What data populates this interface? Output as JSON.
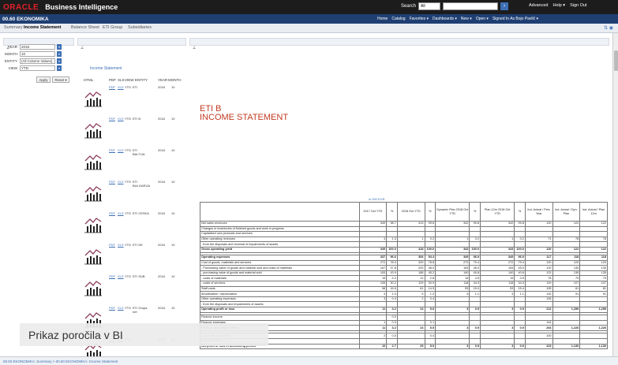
{
  "header": {
    "logo": "ORACLE",
    "title": "Business Intelligence",
    "search_label": "Search",
    "search_scope": "All",
    "links": [
      "Advanced",
      "Help ▾",
      "Sign Out"
    ]
  },
  "subbar": {
    "title": "00.60 EKONOMIKA",
    "links": [
      "Home",
      "Catalog",
      "Favorites ▾",
      "Dashboards ▾",
      "New ▾",
      "Open ▾",
      "Signed In As  Bojo Pavlič ▾"
    ]
  },
  "tabs": [
    "Summary",
    "Income Statement",
    "Balance Sheet",
    "ETI Group",
    "Subsidiaries"
  ],
  "prompts": {
    "year_label": "YEAR",
    "year": "2018",
    "month_label": "MONTH",
    "month": "10",
    "entity_label": "ENTITY",
    "entity": "(All Column Values)",
    "view_label": "VIEW",
    "view": "YTD",
    "apply": "Apply",
    "reset": "Reset ▾"
  },
  "list": {
    "title": "Income Statement",
    "headers": [
      "HTML",
      "PDF",
      "XLS",
      "VIEW",
      "ENTITY",
      "YEAR",
      "MONTH"
    ],
    "rows": [
      {
        "pdf": "PDF",
        "xls": "XLS",
        "view": "YTD",
        "entity": "ETI",
        "year": "2018",
        "month": "10"
      },
      {
        "pdf": "PDF",
        "xls": "XLS",
        "view": "YTD",
        "entity": "ETI B",
        "year": "2018",
        "month": "10"
      },
      {
        "pdf": "PDF",
        "xls": "XLS",
        "view": "YTD",
        "entity": "ETI BALTIJA",
        "year": "2018",
        "month": "10"
      },
      {
        "pdf": "PDF",
        "xls": "XLS",
        "view": "YTD",
        "entity": "ETI BULGARIJA",
        "year": "2018",
        "month": "10"
      },
      {
        "pdf": "PDF",
        "xls": "XLS",
        "view": "YTD",
        "entity": "ETI CESKA",
        "year": "2018",
        "month": "10"
      },
      {
        "pdf": "PDF",
        "xls": "XLS",
        "view": "YTD",
        "entity": "ETI DE",
        "year": "2018",
        "month": "10"
      },
      {
        "pdf": "PDF",
        "xls": "XLS",
        "view": "YTD",
        "entity": "ETI SUB",
        "year": "2018",
        "month": "10"
      },
      {
        "pdf": "PDF",
        "xls": "XLS",
        "view": "YTD",
        "entity": "ETI Grupa net",
        "year": "2018",
        "month": "10"
      },
      {
        "pdf": "PDF",
        "xls": "XLS",
        "view": "YTD",
        "entity": "",
        "year": "2018",
        "month": "10"
      }
    ]
  },
  "report": {
    "title1": "ETI B",
    "title2": "INCOME STATEMENT",
    "units": "in 000 EUR",
    "columns": [
      "",
      "2017 Oct YTD",
      "%",
      "2018 Oct YTD",
      "%",
      "Dynamic Plan 2018 Oct YTD",
      "%",
      "Plan 12m 2018 Oct YTD",
      "%",
      "Ind. Actual / Prev Year",
      "Ind. Actual / Dyn. Plan",
      "Ind. Actual / Plan 12m"
    ],
    "rows": [
      {
        "cells": [
          "Net sales revenues",
          "349",
          "98.7",
          "413",
          "99.6",
          "342",
          "99.8",
          "342",
          "99.8",
          "120",
          "122",
          "122"
        ],
        "bold": false
      },
      {
        "cells": [
          "Changes in inventories of finished goods and work in progress",
          "",
          "",
          "",
          "",
          "",
          "",
          "",
          "",
          "",
          "",
          ""
        ],
        "bold": false
      },
      {
        "cells": [
          "Capitalized own products and services",
          "",
          "",
          "",
          "",
          "",
          "",
          "",
          "",
          "",
          "",
          ""
        ],
        "bold": false
      },
      {
        "cells": [
          "Other operating revenues",
          "4",
          "1.3",
          "1",
          "0.2",
          "1",
          "0.2",
          "1",
          "0.2",
          "71",
          "78",
          "78"
        ],
        "bold": false
      },
      {
        "cells": [
          "- from the disposals and reversal of impairments of assets",
          "",
          "",
          "",
          "",
          "",
          "",
          "",
          "",
          "",
          "",
          ""
        ],
        "bold": false
      },
      {
        "cells": [
          "Gross operating yield",
          "349",
          "100.0",
          "418",
          "100.0",
          "343",
          "100.0",
          "343",
          "100.0",
          "120",
          "122",
          "122"
        ],
        "bold": true
      },
      {
        "cells": [
          "",
          "",
          "",
          "",
          "",
          "",
          "",
          "",
          "",
          "",
          "",
          ""
        ],
        "bold": false,
        "gap": true
      },
      {
        "cells": [
          "Operating expenses",
          "337",
          "96.6",
          "394",
          "94.4",
          "349",
          "96.9",
          "349",
          "96.9",
          "117",
          "118",
          "118"
        ],
        "bold": true
      },
      {
        "cells": [
          "Cost of goods, materials and services",
          "272",
          "78.0",
          "329",
          "78.8",
          "272",
          "79.4",
          "272",
          "79.4",
          "120",
          "120",
          "120"
        ],
        "bold": false
      },
      {
        "cells": [
          "- Purchasing value of goods and material sold and costs of materials",
          "167",
          "47.8",
          "200",
          "48.0",
          "154",
          "45.0",
          "154",
          "45.0",
          "120",
          "130",
          "130"
        ],
        "bold": false
      },
      {
        "cells": [
          "- purchasing value of goods and material sold",
          "153",
          "43.9",
          "188",
          "45.2",
          "140",
          "40.8",
          "140",
          "40.8",
          "123",
          "135",
          "135"
        ],
        "bold": false
      },
      {
        "cells": [
          "- costs of materials",
          "15",
          "4.2",
          "12",
          "2.8",
          "16",
          "4.5",
          "15",
          "4.5",
          "78",
          "79",
          "79"
        ],
        "bold": false
      },
      {
        "cells": [
          "- costs of services",
          "105",
          "30.2",
          "129",
          "30.9",
          "118",
          "34.3",
          "118",
          "34.3",
          "119",
          "107",
          "107"
        ],
        "bold": false
      },
      {
        "cells": [
          "Staff costs",
          "58",
          "16.6",
          "61",
          "14.5",
          "53",
          "15.4",
          "53",
          "15.4",
          "105",
          "81",
          "81"
        ],
        "bold": false
      },
      {
        "cells": [
          "Amortization / depreciation",
          "4",
          "1.0",
          "5",
          "1.2",
          "4",
          "1.1",
          "4",
          "1.1",
          "132",
          "91",
          "91"
        ],
        "bold": false
      },
      {
        "cells": [
          "Other operating expenses",
          "3",
          "0.4",
          "2",
          "0.4",
          "",
          "",
          "",
          "",
          "126",
          "",
          ""
        ],
        "bold": false
      },
      {
        "cells": [
          "- from the disposals and impairments of assets",
          "",
          "",
          "",
          "",
          "",
          "",
          "",
          "",
          "",
          "",
          ""
        ],
        "bold": false
      },
      {
        "cells": [
          "Operating profit or loss",
          "11",
          "3.2",
          "24",
          "5.6",
          "3",
          "0.9",
          "3",
          "0.9",
          "212",
          "1,256",
          "1,256"
        ],
        "bold": true
      },
      {
        "cells": [
          "",
          "",
          "",
          "",
          "",
          "",
          "",
          "",
          "",
          "",
          "",
          ""
        ],
        "bold": false,
        "gap": true
      },
      {
        "cells": [
          "Finance income",
          "",
          "0.0",
          "",
          "",
          "",
          "",
          "",
          "",
          "",
          "",
          ""
        ],
        "bold": false
      },
      {
        "cells": [
          "Finance expenses",
          "1",
          "0.3",
          "",
          "0.1",
          "",
          "",
          "",
          "",
          "144",
          "",
          ""
        ],
        "bold": false
      },
      {
        "cells": [
          "Profit or loss before taxes",
          "11",
          "3.2",
          "23",
          "5.5",
          "3",
          "0.9",
          "3",
          "0.9",
          "204",
          "1,226",
          "1,226"
        ],
        "bold": true
      },
      {
        "cells": [
          "",
          "",
          "",
          "",
          "",
          "",
          "",
          "",
          "",
          "",
          "",
          ""
        ],
        "bold": false,
        "gap": true
      },
      {
        "cells": [
          "Corporate income tax",
          "2",
          "0.5",
          "",
          "0.4",
          "",
          "",
          "",
          "",
          "100",
          "",
          ""
        ],
        "bold": false
      },
      {
        "cells": [
          "Deferred taxes",
          "",
          "",
          "",
          "",
          "",
          "",
          "",
          "",
          "",
          "",
          ""
        ],
        "bold": false
      },
      {
        "cells": [
          "Net profit or loss in accounting period",
          "10",
          "2.7",
          "29",
          "5.0",
          "3",
          "0.9",
          "3",
          "0.9",
          "223",
          "1,130",
          "1,130"
        ],
        "bold": true
      }
    ]
  },
  "footer": "00.60 EKONOMIKA: Summary  >  00.60 EKONOMIKA: Income Statement",
  "caption": "Prikaz poročila v BI"
}
